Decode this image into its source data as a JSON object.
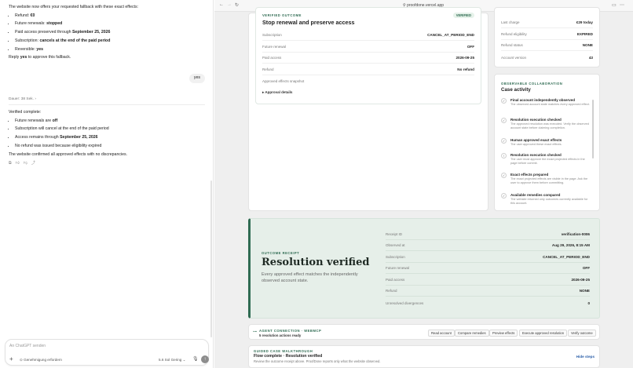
{
  "chat": {
    "intro": "The website now offers your requested fallback with these exact effects:",
    "effects": [
      {
        "label": "Refund:",
        "value": "€0"
      },
      {
        "label": "Future renewals:",
        "value": "stopped"
      },
      {
        "label": "Paid access preserved through",
        "value": "September 25, 2026"
      },
      {
        "label": "Subscription:",
        "value": "cancels at the end of the paid period"
      },
      {
        "label": "Reversible:",
        "value": "yes"
      }
    ],
    "reply_pre": "Reply ",
    "reply_bold": "yes",
    "reply_post": " to approve this fallback.",
    "user_message": "yes",
    "thought": "Dauer: 38 Sek.  ›",
    "verified": "Verified complete:",
    "final": [
      {
        "pre": "Future renewals are ",
        "bold": "off",
        "post": ""
      },
      {
        "pre": "Subscription will cancel at the end of the paid period",
        "bold": "",
        "post": ""
      },
      {
        "pre": "Access remains through ",
        "bold": "September 25, 2026",
        "post": ""
      },
      {
        "pre": "No refund was issued because eligibility expired",
        "bold": "",
        "post": ""
      }
    ],
    "conclusion": "The website confirmed all approved effects with no discrepancies.",
    "composer": {
      "placeholder": "An ChatGPT senden",
      "permission": "Genehmigung erfordern",
      "model": "5.6 Sol  Gering  ⌄",
      "plus": "+",
      "mic": "🎙",
      "send": "↑"
    }
  },
  "browser": {
    "url": "proofdone.vercel.app",
    "verified_outcome": {
      "kicker": "VERIFIED OUTCOME",
      "title": "Stop renewal and preserve access",
      "badge": "VERIFIED",
      "rows": [
        {
          "label": "Subscription",
          "value": "CANCEL_AT_PERIOD_END"
        },
        {
          "label": "Future renewal",
          "value": "OFF"
        },
        {
          "label": "Paid access",
          "value": "2026-09-25"
        },
        {
          "label": "Refund",
          "value": "No refund"
        }
      ],
      "snapshot_label": "Approved effects snapshot",
      "approval_details": "▸ Approval details"
    },
    "account": {
      "rows": [
        {
          "label": "Last charge",
          "value": "€29 today"
        },
        {
          "label": "Refund eligibility",
          "value": "EXPIRED"
        },
        {
          "label": "Refund status",
          "value": "NONE"
        },
        {
          "label": "Account version",
          "value": "43"
        }
      ]
    },
    "collaboration": {
      "kicker": "OBSERVABLE COLLABORATION",
      "title": "Case activity",
      "items": [
        {
          "icon": "✓",
          "title": "Final account independently observed",
          "desc": "The observed account state matches every approved effect."
        },
        {
          "icon": "✓",
          "title": "Resolution execution checked",
          "desc": "The approved resolution was executed. Verify the observed account state before claiming completion."
        },
        {
          "icon": "✓",
          "title": "Human approved exact effects",
          "desc": "The user approved these exact effects."
        },
        {
          "icon": "!",
          "title": "Resolution execution checked",
          "desc": "The user must approve the exact projected effects in the page before commit."
        },
        {
          "icon": "✓",
          "title": "Exact effects prepared",
          "desc": "The exact projected effects are visible in the page. Ask the user to approve them before committing."
        },
        {
          "icon": "✓",
          "title": "Available remedies compared",
          "desc": "The website returned only outcomes currently available for this account."
        }
      ]
    },
    "receipt": {
      "kicker": "OUTCOME RECEIPT",
      "title": "Resolution verified",
      "desc": "Every approved effect matches the independently observed account state.",
      "rows": [
        {
          "label": "Receipt ID",
          "value": "verification-0006"
        },
        {
          "label": "Observed at",
          "value": "Aug 29, 2026, 8:15 AM"
        },
        {
          "label": "Subscription",
          "value": "CANCEL_AT_PERIOD_END"
        },
        {
          "label": "Future renewal",
          "value": "OFF"
        },
        {
          "label": "Paid access",
          "value": "2026-09-25"
        },
        {
          "label": "Refund",
          "value": "NONE"
        },
        {
          "label": "Unresolved divergences",
          "value": "0"
        }
      ]
    },
    "agent": {
      "kicker": "AGENT CONNECTION · WEBMCP",
      "status": "5 resolution actions ready",
      "buttons": [
        "Read account",
        "Compare remedies",
        "Preview effects",
        "Execute approved resolution",
        "Verify outcome"
      ]
    },
    "walkthrough": {
      "kicker": "GUIDED CASE WALKTHROUGH",
      "title": "Flow complete · Resolution verified",
      "desc": "Review the outcome receipt above. ProofDone reports only what the website observed.",
      "hide": "Hide steps"
    }
  },
  "colors": {
    "accent": "#2f6b52",
    "receipt_bg": "#e6efe9"
  }
}
